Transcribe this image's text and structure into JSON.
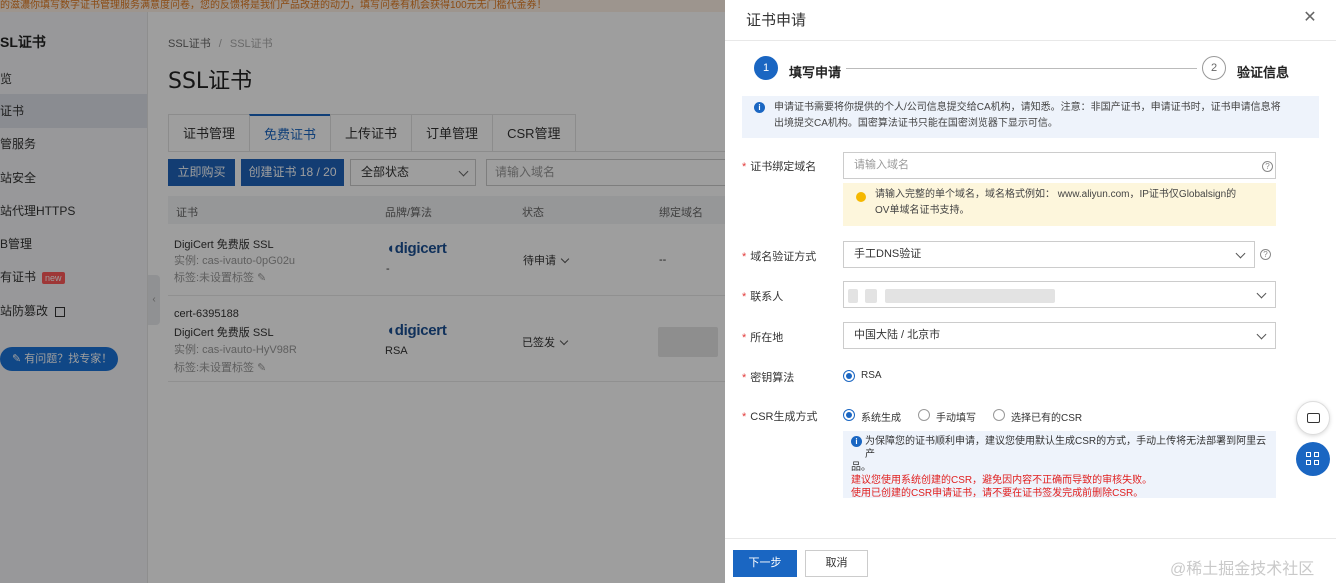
{
  "background": {
    "banner": "的滋濃你填写数字证书管理服务满意度问卷，您的反馈将是我们产品改进的动力，填写问卷有机会获得100元无门槛代金券！",
    "nav_title": "SL证书",
    "nav_items": [
      {
        "label": "览"
      },
      {
        "label": "证书"
      },
      {
        "label": "管服务"
      },
      {
        "label": "站安全"
      },
      {
        "label": "站代理HTTPS"
      },
      {
        "label": "B管理"
      },
      {
        "label": "有证书",
        "badge": "new"
      },
      {
        "label": "站防篡改"
      }
    ],
    "help_label": "有问题？找专家！",
    "breadcrumb": [
      "SSL证书",
      "SSL证书"
    ],
    "page_title": "SSL证书",
    "tabs": [
      "证书管理",
      "免费证书",
      "上传证书",
      "订单管理",
      "CSR管理"
    ],
    "buy_button": "立即购买",
    "create_button": "创建证书 18 / 20",
    "status_filter": "全部状态",
    "search_placeholder": "请输入域名",
    "columns": [
      "证书",
      "品牌/算法",
      "状态",
      "绑定域名"
    ],
    "rows": [
      {
        "name": "DigiCert 免费版 SSL",
        "instance": "实例: cas-ivauto-0pG02u",
        "tags": "标签:未设置标签",
        "brand": "digicert",
        "algo": "-",
        "status": "待申请",
        "domain": "--"
      },
      {
        "id": "cert-6395188",
        "name": "DigiCert 免费版 SSL",
        "instance": "实例: cas-ivauto-HyV98R",
        "tags": "标签:未设置标签",
        "brand": "digicert",
        "algo": "RSA",
        "status": "已签发",
        "domain": ""
      }
    ]
  },
  "drawer": {
    "title": "证书申请",
    "close_icon": "close-icon",
    "steps": [
      {
        "num": "1",
        "label": "填写申请"
      },
      {
        "num": "2",
        "label": "验证信息"
      }
    ],
    "notice_line1": "申请证书需要将你提供的个人/公司信息提交给CA机构，请知悉。注意：非国产证书，申请证书时，证书申请信息将",
    "notice_line2": "出境提交CA机构。国密算法证书只能在国密浏览器下显示可信。",
    "fields": {
      "domain_label": "证书绑定域名",
      "domain_placeholder": "请输入域名",
      "domain_tip_line1": "请输入完整的单个域名，域名格式例如：  www.aliyun.com，IP证书仅Globalsign的",
      "domain_tip_line2": "OV单域名证书支持。",
      "verify_label": "域名验证方式",
      "verify_value": "手工DNS验证",
      "contact_label": "联系人",
      "location_label": "所在地",
      "location_value": "中国大陆 / 北京市",
      "algo_label": "密钥算法",
      "algo_value": "RSA",
      "csr_label": "CSR生成方式",
      "csr_options": [
        "系统生成",
        "手动填写",
        "选择已有的CSR"
      ],
      "csr_tip_line1": "为保障您的证书顺利申请，建议您使用默认生成CSR的方式，手动上传将无法部署到阿里云产",
      "csr_tip_line2": "品。",
      "csr_tip_red1": "建议您使用系统创建的CSR，避免因内容不正确而导致的审核失败。",
      "csr_tip_red2": "使用已创建的CSR申请证书，请不要在证书签发完成前删除CSR。"
    },
    "next_button": "下一步",
    "cancel_button": "取消",
    "watermark": "@稀土掘金技术社区"
  },
  "colors": {
    "primary": "#1a66c2",
    "required": "#e23b3b",
    "warning_bg": "#fdf6dc",
    "info_bg": "#eef3fb"
  }
}
